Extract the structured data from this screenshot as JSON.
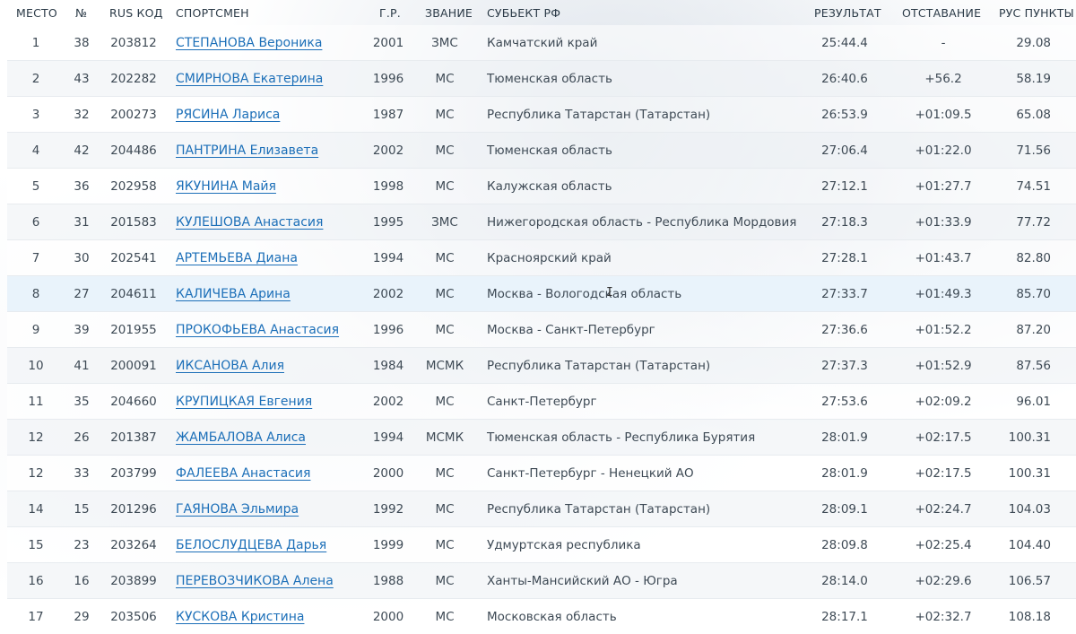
{
  "headers": {
    "place": "МЕСТО",
    "num": "№",
    "code": "RUS КОД",
    "name": "СПОРТСМЕН",
    "year": "Г.Р.",
    "rank": "ЗВАНИЕ",
    "region": "СУБЬЕКТ РФ",
    "result": "РЕЗУЛЬТАТ",
    "gap": "ОТСТАВАНИЕ",
    "points": "РУС ПУНКТЫ"
  },
  "rows": [
    {
      "place": "1",
      "num": "38",
      "code": "203812",
      "name": "СТЕПАНОВА Вероника",
      "year": "2001",
      "rank": "ЗМС",
      "region": "Камчатский край",
      "result": "25:44.4",
      "gap": "-",
      "points": "29.08"
    },
    {
      "place": "2",
      "num": "43",
      "code": "202282",
      "name": "СМИРНОВА Екатерина",
      "year": "1996",
      "rank": "МС",
      "region": "Тюменская область",
      "result": "26:40.6",
      "gap": "+56.2",
      "points": "58.19"
    },
    {
      "place": "3",
      "num": "32",
      "code": "200273",
      "name": "РЯСИНА Лариса",
      "year": "1987",
      "rank": "МС",
      "region": "Республика Татарстан (Татарстан)",
      "result": "26:53.9",
      "gap": "+01:09.5",
      "points": "65.08"
    },
    {
      "place": "4",
      "num": "42",
      "code": "204486",
      "name": "ПАНТРИНА Елизавета",
      "year": "2002",
      "rank": "МС",
      "region": "Тюменская область",
      "result": "27:06.4",
      "gap": "+01:22.0",
      "points": "71.56"
    },
    {
      "place": "5",
      "num": "36",
      "code": "202958",
      "name": "ЯКУНИНА Майя",
      "year": "1998",
      "rank": "МС",
      "region": "Калужская область",
      "result": "27:12.1",
      "gap": "+01:27.7",
      "points": "74.51"
    },
    {
      "place": "6",
      "num": "31",
      "code": "201583",
      "name": "КУЛЕШОВА Анастасия",
      "year": "1995",
      "rank": "ЗМС",
      "region": "Нижегородская область - Республика Мордовия",
      "result": "27:18.3",
      "gap": "+01:33.9",
      "points": "77.72"
    },
    {
      "place": "7",
      "num": "30",
      "code": "202541",
      "name": "АРТЕМЬЕВА Диана",
      "year": "1994",
      "rank": "МС",
      "region": "Красноярский край",
      "result": "27:28.1",
      "gap": "+01:43.7",
      "points": "82.80"
    },
    {
      "place": "8",
      "num": "27",
      "code": "204611",
      "name": "КАЛИЧЕВА Арина",
      "year": "2002",
      "rank": "МС",
      "region": "Москва - Вологодская область",
      "result": "27:33.7",
      "gap": "+01:49.3",
      "points": "85.70"
    },
    {
      "place": "9",
      "num": "39",
      "code": "201955",
      "name": "ПРОКОФЬЕВА Анастасия",
      "year": "1996",
      "rank": "МС",
      "region": "Москва - Санкт-Петербург",
      "result": "27:36.6",
      "gap": "+01:52.2",
      "points": "87.20"
    },
    {
      "place": "10",
      "num": "41",
      "code": "200091",
      "name": "ИКСАНОВА Алия",
      "year": "1984",
      "rank": "МСМК",
      "region": "Республика Татарстан (Татарстан)",
      "result": "27:37.3",
      "gap": "+01:52.9",
      "points": "87.56"
    },
    {
      "place": "11",
      "num": "35",
      "code": "204660",
      "name": "КРУПИЦКАЯ Евгения",
      "year": "2002",
      "rank": "МС",
      "region": "Санкт-Петербург",
      "result": "27:53.6",
      "gap": "+02:09.2",
      "points": "96.01"
    },
    {
      "place": "12",
      "num": "26",
      "code": "201387",
      "name": "ЖАМБАЛОВА Алиса",
      "year": "1994",
      "rank": "МСМК",
      "region": "Тюменская область - Республика Бурятия",
      "result": "28:01.9",
      "gap": "+02:17.5",
      "points": "100.31"
    },
    {
      "place": "12",
      "num": "33",
      "code": "203799",
      "name": "ФАЛЕЕВА Анастасия",
      "year": "2000",
      "rank": "МС",
      "region": "Санкт-Петербург - Ненецкий АО",
      "result": "28:01.9",
      "gap": "+02:17.5",
      "points": "100.31"
    },
    {
      "place": "14",
      "num": "15",
      "code": "201296",
      "name": "ГАЯНОВА Эльмира",
      "year": "1992",
      "rank": "МС",
      "region": "Республика Татарстан (Татарстан)",
      "result": "28:09.1",
      "gap": "+02:24.7",
      "points": "104.03"
    },
    {
      "place": "15",
      "num": "23",
      "code": "203264",
      "name": "БЕЛОСЛУДЦЕВА Дарья",
      "year": "1999",
      "rank": "МС",
      "region": "Удмуртская республика",
      "result": "28:09.8",
      "gap": "+02:25.4",
      "points": "104.40"
    },
    {
      "place": "16",
      "num": "16",
      "code": "203899",
      "name": "ПЕРЕВОЗЧИКОВА Алена",
      "year": "1988",
      "rank": "МС",
      "region": "Ханты-Мансийский АО - Югра",
      "result": "28:14.0",
      "gap": "+02:29.6",
      "points": "106.57"
    },
    {
      "place": "17",
      "num": "29",
      "code": "203506",
      "name": "КУСКОВА Кристина",
      "year": "2000",
      "rank": "МС",
      "region": "Московская область",
      "result": "28:17.1",
      "gap": "+02:32.7",
      "points": "108.18"
    }
  ],
  "hovered_row_index": 7,
  "cursor": {
    "icon": "text-cursor-icon",
    "glyph": "I"
  },
  "colors": {
    "link": "#1c6fb8",
    "text": "#3e4a55",
    "header_text": "#2b3a47",
    "row_alt": "#f1f4f7",
    "row_hover": "#e9f3fb"
  }
}
